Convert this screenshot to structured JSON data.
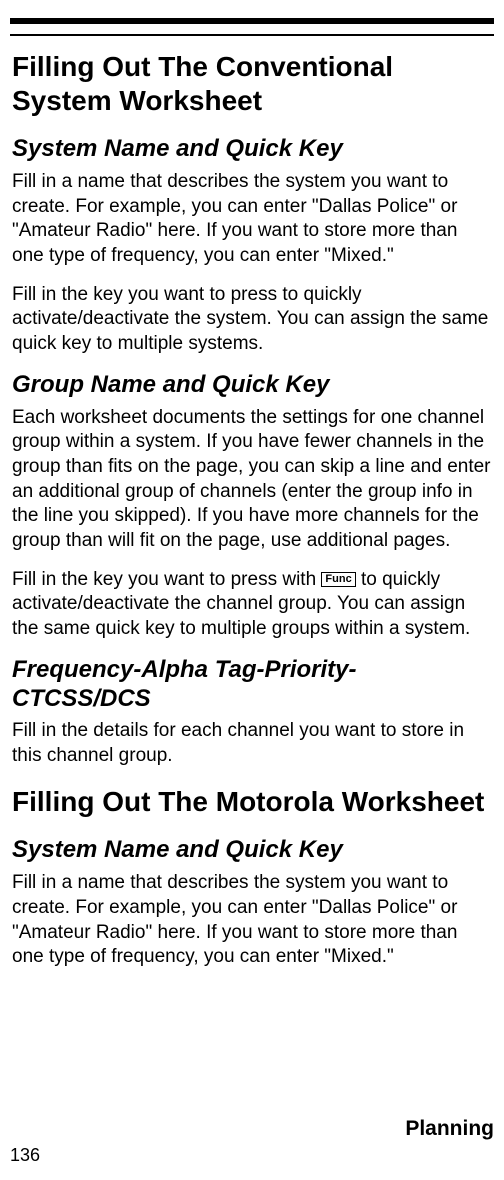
{
  "headings": {
    "h1_conventional": "Filling Out The Conventional System Worksheet",
    "h2_sysname1": "System Name and Quick Key",
    "h2_groupname": "Group Name and Quick Key",
    "h2_freq": "Frequency-Alpha Tag-Priority-CTCSS/DCS",
    "h1_motorola": "Filling Out The Motorola Worksheet",
    "h2_sysname2": "System Name and Quick Key"
  },
  "paragraphs": {
    "p1": "Fill in a name that describes the system you want to create. For example, you can enter \"Dallas Police\" or \"Amateur Radio\" here. If you want to store more than one type of frequency, you can enter \"Mixed.\"",
    "p2": "Fill in the key you want to press to quickly activate/deactivate the system. You can assign the same quick key to multiple systems.",
    "p3": "Each worksheet documents the settings for one channel group within a system. If you have fewer channels in the group than fits on the page, you can skip a line and enter an additional group of channels (enter the group info in the line you skipped). If you have more channels for the group than will fit on the page, use additional pages.",
    "p4_before": "Fill in the key you want to press with ",
    "p4_func": "Func",
    "p4_after": " to quickly activate/deactivate the channel group. You can assign the same quick key to multiple groups within a system.",
    "p5": "Fill in the details for each channel you want to store in this channel group.",
    "p6": "Fill in a name that describes the system you want to create. For example, you can enter \"Dallas Police\" or \"Amateur Radio\" here. If you want to store more than one type of frequency, you can enter \"Mixed.\""
  },
  "footer": {
    "section_label": "Planning",
    "page_number": "136"
  }
}
